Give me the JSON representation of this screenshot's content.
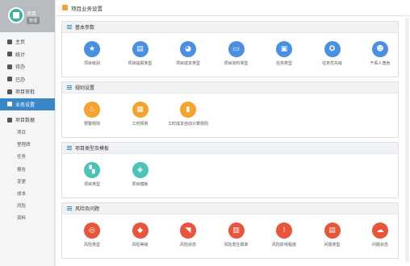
{
  "sidebar": {
    "project_title": "项目",
    "project_badge": "管理",
    "nav": [
      {
        "label": "主页",
        "icon": "home-icon"
      },
      {
        "label": "统计",
        "icon": "stats-icon"
      },
      {
        "label": "待办",
        "icon": "todo-icon"
      },
      {
        "label": "已办",
        "icon": "done-icon"
      },
      {
        "label": "项目审批",
        "icon": "approve-icon"
      },
      {
        "label": "业务设置",
        "icon": "settings-icon",
        "active": true
      }
    ],
    "group_label": "项目数据",
    "group_items": [
      "项目",
      "里程碑",
      "任务",
      "报告",
      "变更",
      "成本",
      "风险",
      "资料"
    ]
  },
  "topbar": {
    "title": "项目业务设置"
  },
  "sections": [
    {
      "title": "基本参数",
      "items": [
        {
          "label": "项目级别",
          "icon": "star-icon",
          "color": "#4a90e2",
          "glyph": "★"
        },
        {
          "label": "项目提报类型",
          "icon": "document-icon",
          "color": "#4a90e2",
          "glyph": "▤"
        },
        {
          "label": "项目成本类型",
          "icon": "pie-chart-icon",
          "color": "#4a90e2",
          "glyph": "◕"
        },
        {
          "label": "项目资料类型",
          "icon": "folder-icon",
          "color": "#4a90e2",
          "glyph": "▭"
        },
        {
          "label": "任务类型",
          "icon": "briefcase-icon",
          "color": "#4a90e2",
          "glyph": "▣"
        },
        {
          "label": "任务优先级",
          "icon": "ribbon-icon",
          "color": "#4a90e2",
          "glyph": "✪"
        },
        {
          "label": "干系人角色",
          "icon": "user-icon",
          "color": "#4a90e2",
          "glyph": "☻"
        }
      ]
    },
    {
      "title": "规则设置",
      "items": [
        {
          "label": "预警规则",
          "icon": "drop-icon",
          "color": "#f5a22e",
          "glyph": "♨"
        },
        {
          "label": "工时规则",
          "icon": "calendar-icon",
          "color": "#f5a22e",
          "glyph": "▦"
        },
        {
          "label": "工时成本自动计算规则",
          "icon": "bar-chart-icon",
          "color": "#f5a22e",
          "glyph": "▮"
        }
      ]
    },
    {
      "title": "项目类型及模板",
      "items": [
        {
          "label": "项目类型",
          "icon": "grid-icon",
          "color": "#4cc3b5",
          "glyph": "▚"
        },
        {
          "label": "项目模板",
          "icon": "layers-icon",
          "color": "#4cc3b5",
          "glyph": "◈"
        }
      ]
    },
    {
      "title": "风险及问题",
      "items": [
        {
          "label": "风险类型",
          "icon": "target-icon",
          "color": "#e8553a",
          "glyph": "◎"
        },
        {
          "label": "风险等级",
          "icon": "shield-icon",
          "color": "#e8553a",
          "glyph": "◆"
        },
        {
          "label": "风险状态",
          "icon": "tag-icon",
          "color": "#e8553a",
          "glyph": "◥"
        },
        {
          "label": "风险发生概率",
          "icon": "chart-icon",
          "color": "#e8553a",
          "glyph": "▥"
        },
        {
          "label": "风险影响程度",
          "icon": "alert-icon",
          "color": "#e8553a",
          "glyph": "!"
        },
        {
          "label": "问题类型",
          "icon": "file-icon",
          "color": "#e8553a",
          "glyph": "▤"
        },
        {
          "label": "问题状态",
          "icon": "cloud-icon",
          "color": "#e8553a",
          "glyph": "☁"
        }
      ]
    }
  ]
}
